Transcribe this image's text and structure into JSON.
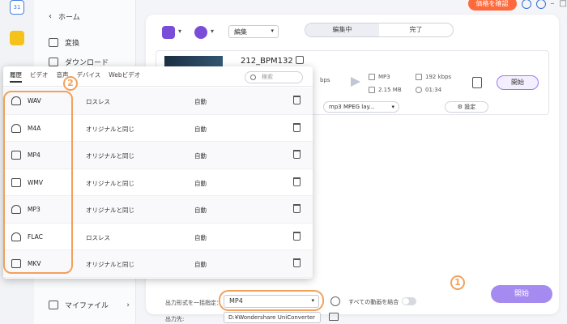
{
  "dock": {
    "calendar_day": "31"
  },
  "sidebar": {
    "items": [
      {
        "label": "ホーム",
        "icon": "chevron-left-icon"
      },
      {
        "label": "変換",
        "icon": "convert-icon"
      },
      {
        "label": "ダウンロード",
        "icon": "download-icon"
      }
    ],
    "bottom_item": {
      "label": "マイファイル",
      "icon": "folder-icon",
      "chevron": "›"
    }
  },
  "topbar": {
    "buy_label": "価格を確認"
  },
  "toolbar": {
    "add_file_icon": "add-file-icon",
    "add_dvd_icon": "add-dvd-icon",
    "edit_select": "編集",
    "tabs": [
      {
        "label": "編集中",
        "active": true
      },
      {
        "label": "完了",
        "active": false
      }
    ]
  },
  "file": {
    "name": "212_BPM132",
    "source_bitrate": "bps",
    "target_format": "MP3",
    "target_size": "2.15 MB",
    "target_bitrate": "192 kbps",
    "target_duration": "01:34",
    "convert_label": "開始",
    "codec": "mp3 MPEG lay...",
    "settings_label": "設定"
  },
  "popup": {
    "tabs": [
      "履歴",
      "ビデオ",
      "音声",
      "デバイス",
      "Webビデオ"
    ],
    "active_tab": "履歴",
    "search_placeholder": "検索",
    "rows": [
      {
        "name": "WAV",
        "quality": "ロスレス",
        "auto": "自動",
        "kind": "audio"
      },
      {
        "name": "M4A",
        "quality": "オリジナルと同じ",
        "auto": "自動",
        "kind": "audio"
      },
      {
        "name": "MP4",
        "quality": "オリジナルと同じ",
        "auto": "自動",
        "kind": "video"
      },
      {
        "name": "WMV",
        "quality": "オリジナルと同じ",
        "auto": "自動",
        "kind": "video"
      },
      {
        "name": "MP3",
        "quality": "オリジナルと同じ",
        "auto": "自動",
        "kind": "audio"
      },
      {
        "name": "FLAC",
        "quality": "ロスレス",
        "auto": "自動",
        "kind": "audio"
      },
      {
        "name": "MKV",
        "quality": "オリジナルと同じ",
        "auto": "自動",
        "kind": "video"
      }
    ]
  },
  "bottom": {
    "output_format_label": "出力形式を一括指定：",
    "output_format_value": "MP4",
    "merge_label": "すべての動画を結合",
    "output_path_label": "出力先:",
    "output_path_value": "D:¥Wondershare UniConverter",
    "start_label": "開始"
  },
  "callouts": {
    "one": "1",
    "two": "2"
  },
  "colors": {
    "accent": "#a58bf0",
    "highlight": "#f2a15c",
    "buy": "#ff6a3d"
  }
}
